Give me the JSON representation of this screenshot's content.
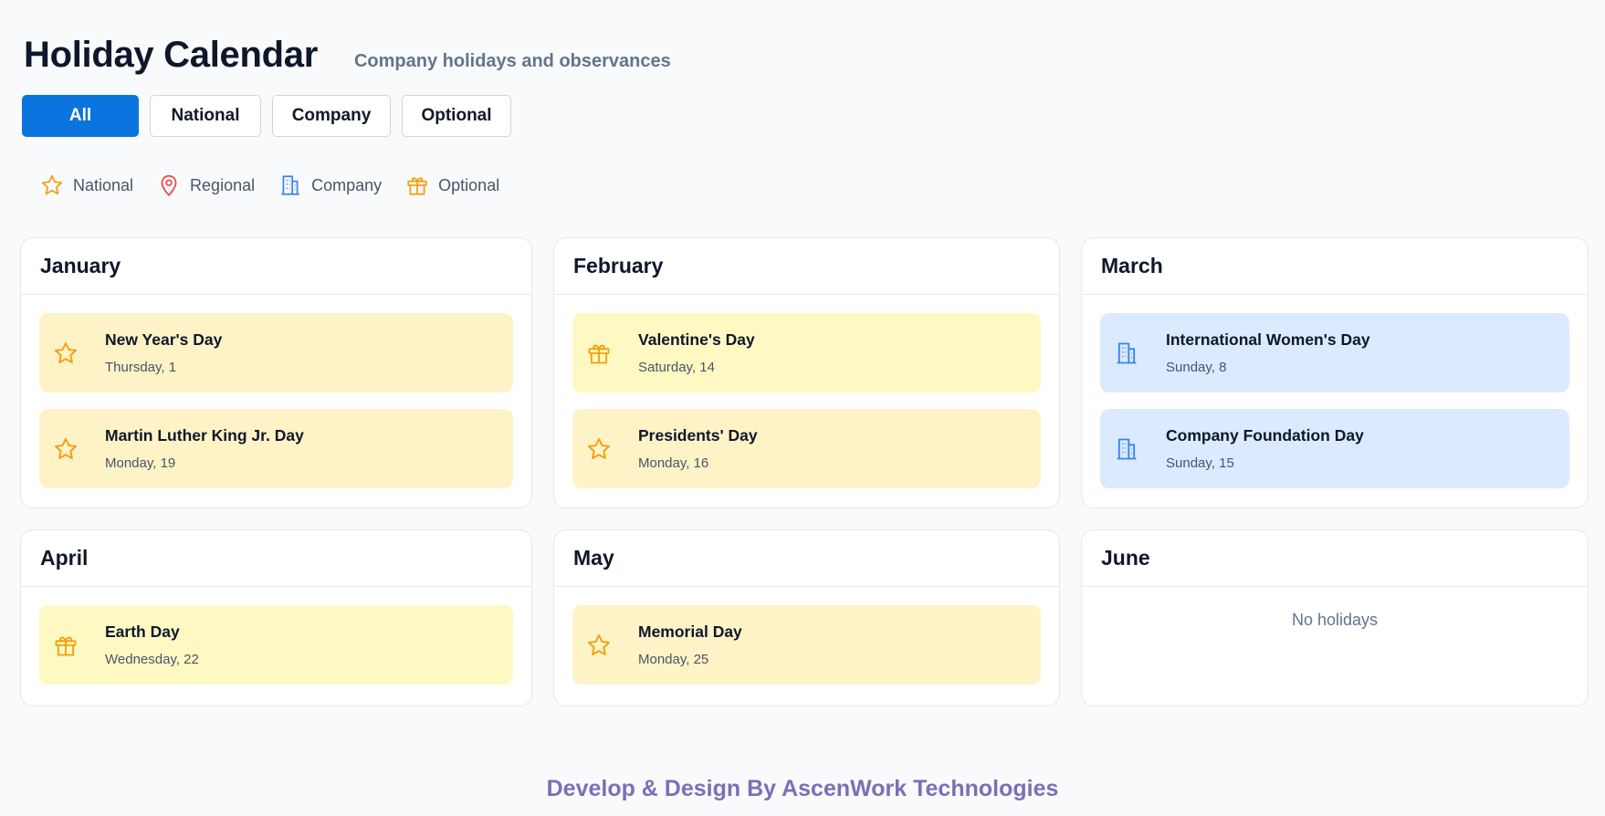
{
  "header": {
    "title": "Holiday Calendar",
    "subtitle": "Company holidays and observances"
  },
  "filters": [
    {
      "label": "All",
      "active": true
    },
    {
      "label": "National",
      "active": false
    },
    {
      "label": "Company",
      "active": false
    },
    {
      "label": "Optional",
      "active": false
    }
  ],
  "legend": [
    {
      "label": "National",
      "icon": "star-icon",
      "color": "#f59e0b"
    },
    {
      "label": "Regional",
      "icon": "map-pin-icon",
      "color": "#ef4444"
    },
    {
      "label": "Company",
      "icon": "building-icon",
      "color": "#3b82f6"
    },
    {
      "label": "Optional",
      "icon": "gift-icon",
      "color": "#f59e0b"
    }
  ],
  "months": [
    {
      "name": "January",
      "holidays": [
        {
          "name": "New Year's Day",
          "date": "Thursday, 1",
          "type": "national",
          "icon": "star-icon"
        },
        {
          "name": "Martin Luther King Jr. Day",
          "date": "Monday, 19",
          "type": "national",
          "icon": "star-icon"
        }
      ]
    },
    {
      "name": "February",
      "holidays": [
        {
          "name": "Valentine's Day",
          "date": "Saturday, 14",
          "type": "optional",
          "icon": "gift-icon"
        },
        {
          "name": "Presidents' Day",
          "date": "Monday, 16",
          "type": "national",
          "icon": "star-icon"
        }
      ]
    },
    {
      "name": "March",
      "holidays": [
        {
          "name": "International Women's Day",
          "date": "Sunday, 8",
          "type": "company",
          "icon": "building-icon"
        },
        {
          "name": "Company Foundation Day",
          "date": "Sunday, 15",
          "type": "company",
          "icon": "building-icon"
        }
      ]
    },
    {
      "name": "April",
      "holidays": [
        {
          "name": "Earth Day",
          "date": "Wednesday, 22",
          "type": "optional",
          "icon": "gift-icon"
        }
      ]
    },
    {
      "name": "May",
      "holidays": [
        {
          "name": "Memorial Day",
          "date": "Monday, 25",
          "type": "national",
          "icon": "star-icon"
        }
      ]
    },
    {
      "name": "June",
      "holidays": [],
      "empty_text": "No holidays"
    }
  ],
  "footer": "Develop & Design By AscenWork Technologies",
  "colors": {
    "accent": "#0b74de",
    "national_bg": "#fef3c7",
    "optional_bg": "#fef9c3",
    "company_bg": "#dbeafe",
    "footer_text": "#7c6fb5"
  }
}
